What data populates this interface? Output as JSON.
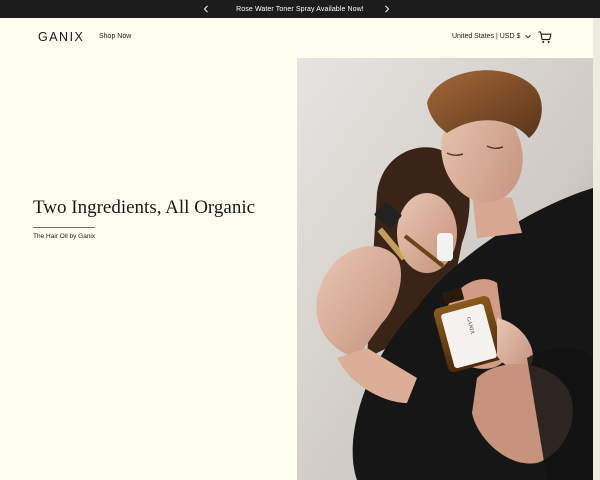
{
  "announcement": {
    "message": "Rose Water Toner Spray Available Now!"
  },
  "header": {
    "logo": "GANIX",
    "nav_shop": "Shop Now",
    "locale": "United States | USD $"
  },
  "hero": {
    "title": "Two Ingredients, All Organic",
    "subtitle": "The Hair Oil by Ganix",
    "bottle_label": "GANIX"
  },
  "colors": {
    "background": "#fdfdf0",
    "announcement_bg": "#1c1c1c",
    "text": "#1a1a1a"
  },
  "icons": {
    "prev": "chevron-left-icon",
    "next": "chevron-right-icon",
    "locale_toggle": "chevron-down-icon",
    "cart": "cart-icon"
  }
}
